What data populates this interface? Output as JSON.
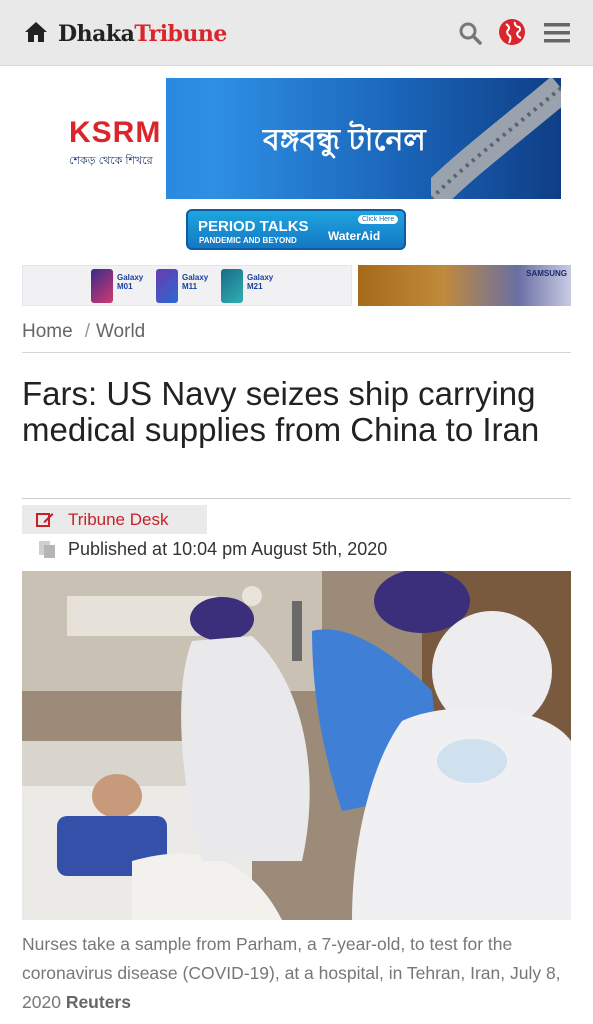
{
  "header": {
    "logo_part1": "Dhaka",
    "logo_part2": "Tribune",
    "icons": [
      "home-icon",
      "search-icon",
      "globe-icon",
      "menu-icon"
    ],
    "brand_color": "#d9252b"
  },
  "ads": {
    "ksrm_banner": {
      "brand": "KSRM",
      "tagline": "শেকড় থেকে শিখরে",
      "headline": "বঙ্গবন্ধু টানেল"
    },
    "period_talks": {
      "title": "PERIOD TALKS",
      "subtitle": "PANDEMIC AND BEYOND",
      "sponsor": "WaterAid",
      "cta": "Click Here"
    },
    "samsung": {
      "brand": "SAMSUNG",
      "models": [
        {
          "line": "Galaxy",
          "model": "M01"
        },
        {
          "line": "Galaxy",
          "model": "M11"
        },
        {
          "line": "Galaxy",
          "model": "M21"
        }
      ]
    }
  },
  "breadcrumb": {
    "home": "Home",
    "separator": "/",
    "section": "World"
  },
  "article": {
    "headline": "Fars: US Navy seizes ship carrying medical supplies from China to Iran",
    "author": "Tribune Desk",
    "published": "Published at 10:04 pm August 5th, 2020",
    "caption": "Nurses take a sample from Parham, a 7-year-old, to test for the coronavirus disease (COVID-19), at a hospital, in Tehran, Iran, July 8, 2020",
    "credit": "Reuters"
  }
}
